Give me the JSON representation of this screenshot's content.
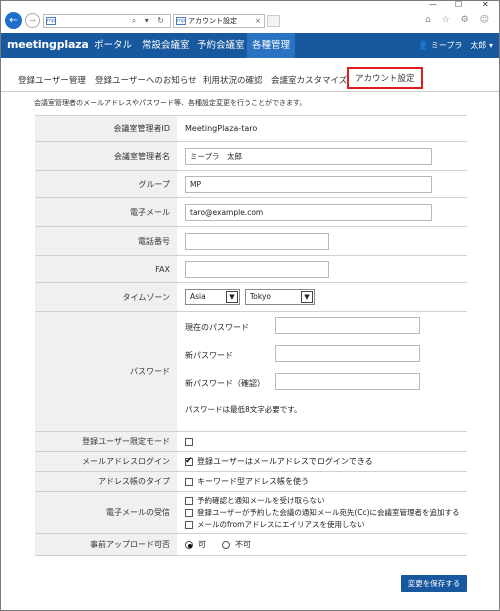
{
  "window": {
    "minimize": "—",
    "maximize": "☐",
    "close": "✕"
  },
  "browser": {
    "address_favicon": "mp",
    "address_icons": "⌕ ▾ ↻",
    "tab_favicon": "mp",
    "tab_title": "アカウント設定",
    "tab_close": "×",
    "right_icons": "⌂ ☆ ⚙ ☺"
  },
  "appnav": {
    "logo": "meetingplaza",
    "items": [
      "ポータル",
      "常設会議室",
      "予約会議室",
      "各種管理"
    ],
    "active_index": 3,
    "user": "👤 ミープラ　太郎 ▾"
  },
  "subtabs": {
    "items": [
      "登録ユーザー管理",
      "登録ユーザーへのお知らせ",
      "利用状況の確認",
      "会議室カスタマイズ",
      "アカウント設定"
    ],
    "active_index": 4
  },
  "description": "会議室管理者のメールアドレスやパスワード等、各種設定変更を行うことができます。",
  "form": {
    "admin_id_label": "会議室管理者ID",
    "admin_id_value": "MeetingPlaza-taro",
    "admin_name_label": "会議室管理者名",
    "admin_name_value": "ミープラ　太郎",
    "group_label": "グループ",
    "group_value": "MP",
    "email_label": "電子メール",
    "email_value": "taro@example.com",
    "phone_label": "電話番号",
    "phone_value": "",
    "fax_label": "FAX",
    "fax_value": "",
    "timezone_label": "タイムゾーン",
    "timezone_region": "Asia",
    "timezone_city": "Tokyo",
    "password_label": "パスワード",
    "current_pw_label": "現在のパスワード",
    "new_pw_label": "新パスワード",
    "confirm_pw_label": "新パスワード（確認）",
    "pw_note": "パスワードは最低8文字必要です。",
    "registered_mode_label": "登録ユーザー限定モード",
    "registered_mode_checked": false,
    "email_login_label": "メールアドレスログイン",
    "email_login_text": "登録ユーザーはメールアドレスでログインできる",
    "email_login_checked": true,
    "addressbook_label": "アドレス帳のタイプ",
    "addressbook_text": "キーワード型アドレス帳を使う",
    "addressbook_checked": false,
    "email_recv_label": "電子メールの受信",
    "email_recv_options": [
      "予約確認と通知メールを受け取らない",
      "登録ユーザーが予約した会議の通知メール宛先(Cc)に会議室管理者を追加する",
      "メールのfromアドレスにエイリアスを使用しない"
    ],
    "upload_label": "事前アップロード可否",
    "upload_yes": "可",
    "upload_no": "不可",
    "upload_selected": "可"
  },
  "save_button": "変更を保存する"
}
